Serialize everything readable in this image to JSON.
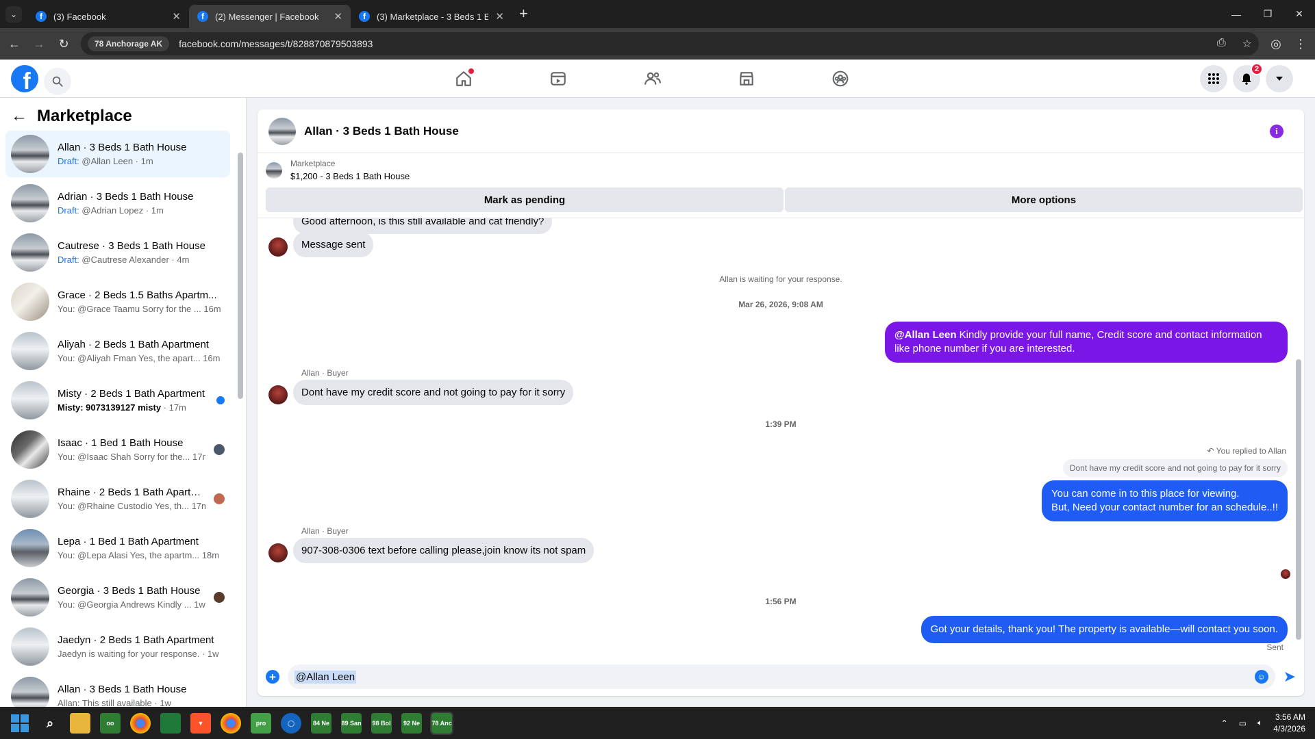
{
  "browser": {
    "tabs": [
      {
        "title": "(3) Facebook"
      },
      {
        "title": "(2) Messenger | Facebook"
      },
      {
        "title": "(3) Marketplace - 3 Beds 1 Bath"
      }
    ],
    "site_chip": "78 Anchorage AK",
    "url": "facebook.com/messages/t/828870879503893"
  },
  "header": {
    "notif_count": "2"
  },
  "sidebar": {
    "title": "Marketplace",
    "items": [
      {
        "name": "Allan · 3 Beds 1 Bath House",
        "draft": "Draft:",
        "preview": " @Allan Leen · 1m",
        "active": true
      },
      {
        "name": "Adrian · 3 Beds 1 Bath House",
        "draft": "Draft:",
        "preview": " @Adrian Lopez · 1m"
      },
      {
        "name": "Cautrese · 3 Beds 1 Bath House",
        "draft": "Draft:",
        "preview": " @Cautrese Alexander · 4m"
      },
      {
        "name": "Grace · 2 Beds 1.5 Baths Apartm...",
        "preview": "You: @Grace Taamu Sorry for the ... 16m"
      },
      {
        "name": "Aliyah · 2 Beds 1 Bath Apartment",
        "preview": "You: @Aliyah Fman Yes, the apart... 16m"
      },
      {
        "name": "Misty · 2 Beds 1 Bath Apartment",
        "preview_bold": "Misty: 9073139127 misty",
        "preview": " · 17m",
        "unread": true
      },
      {
        "name": "Isaac · 1 Bed 1 Bath House",
        "preview": "You: @Isaac Shah Sorry for the... 17m"
      },
      {
        "name": "Rhaine · 2 Beds 1 Bath Apartm...",
        "preview": "You: @Rhaine Custodio Yes, th... 17m"
      },
      {
        "name": "Lepa · 1 Bed 1 Bath Apartment",
        "preview": "You: @Lepa Alasi Yes, the apartm... 18m"
      },
      {
        "name": "Georgia · 3 Beds 1 Bath House",
        "preview": "You: @Georgia Andrews Kindly ... 1w"
      },
      {
        "name": "Jaedyn · 2 Beds 1 Bath Apartment",
        "preview": "Jaedyn is waiting for your response. · 1w"
      },
      {
        "name": "Allan · 3 Beds 1 Bath House",
        "preview": "Allan: This still available · 1w"
      }
    ]
  },
  "chat": {
    "title": "Allan · 3 Beds 1 Bath House",
    "listing_label": "Marketplace",
    "listing_price": "$1,200 - 3 Beds 1 Bath House",
    "mark_pending": "Mark as pending",
    "more_options": "More options",
    "partial_msg": "Good afternoon, is this still available and cat friendly?",
    "msg_sent": "Message sent",
    "waiting": "Allan is waiting for your response.",
    "date1": "Mar 26, 2026, 9:08 AM",
    "out1_mention": "@Allan Leen",
    "out1_text": " Kindly provide your full name, Credit score and contact information like phone number if you are interested.",
    "sender1": "Allan · Buyer",
    "in1": "Dont have my credit score and not going to pay for it sorry",
    "time2": "1:39 PM",
    "replied_label": "You replied to Allan",
    "quoted": "Dont have my credit score and not going to pay for it sorry",
    "out2_line1": "You can come in to this place for viewing.",
    "out2_line2": "But, Need your contact number for an schedule..!!",
    "sender2": "Allan · Buyer",
    "in2": "907-308-0306 text before calling please,join know its not spam",
    "time3": "1:56 PM",
    "out3": "Got your details, thank you! The property is available—will contact you soon.",
    "sent": "Sent",
    "composer_mention": "@Allan Leen"
  },
  "taskbar": {
    "time": "3:56 AM",
    "date": "4/3/2026",
    "apps": [
      "84 Ne",
      "89 San",
      "98 Bol",
      "92 Ne",
      "78 Anc"
    ]
  }
}
